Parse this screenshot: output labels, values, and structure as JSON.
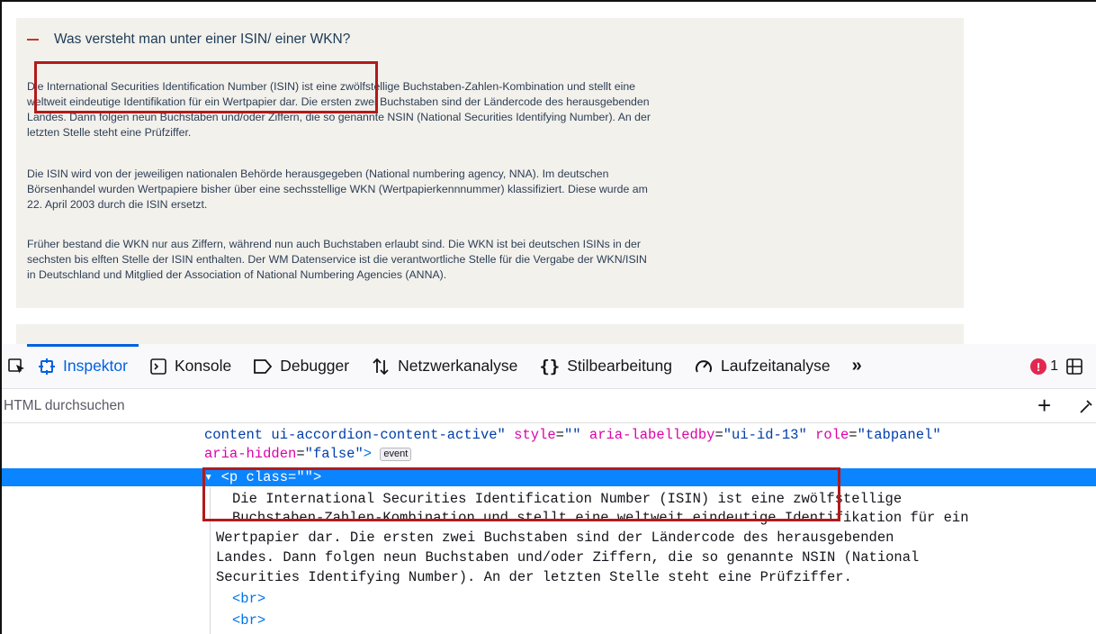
{
  "accordion": {
    "title": "Was versteht man unter einer ISIN/ einer WKN?",
    "paragraphs": [
      [
        "Die International Securities Identification Number (ISIN) ist eine zwölfstellige Buchstaben-Zahlen-Kombination und stellt eine",
        "weltweit eindeutige Identifikation für ein Wertpapier dar. Die ersten zwei Buchstaben sind der Ländercode des herausgebenden",
        "Landes. Dann folgen neun Buchstaben und/oder Ziffern, die so genannte NSIN (National Securities Identifying Number). An der",
        "letzten Stelle steht eine Prüfziffer."
      ],
      [
        "Die ISIN wird von der jeweiligen nationalen Behörde herausgegeben (National numbering agency, NNA). Im deutschen",
        "Börsenhandel wurden Wertpapiere bisher über eine sechsstellige WKN (Wertpapierkennnummer) klassifiziert. Diese wurde am",
        "22. April 2003 durch die ISIN ersetzt."
      ],
      [
        "Früher bestand die WKN nur aus Ziffern, während nun auch Buchstaben erlaubt sind. Die WKN ist bei deutschen ISINs in der",
        "sechsten bis elften Stelle der ISIN enthalten. Der WM Datenservice ist die verantwortliche Stelle für die Vergabe der WKN/ISIN",
        "in Deutschland und Mitglied der Association of National Numbering Agencies (ANNA)."
      ]
    ]
  },
  "devtools": {
    "tabs": [
      {
        "label": "Inspektor",
        "icon": "inspector-icon",
        "active": true
      },
      {
        "label": "Konsole",
        "icon": "console-icon",
        "active": false
      },
      {
        "label": "Debugger",
        "icon": "debugger-icon",
        "active": false
      },
      {
        "label": "Netzwerkanalyse",
        "icon": "network-icon",
        "active": false
      },
      {
        "label": "Stilbearbeitung",
        "icon": "style-editor-icon",
        "active": false
      },
      {
        "label": "Laufzeitanalyse",
        "icon": "performance-icon",
        "active": false
      }
    ],
    "more_tabs": "»",
    "error_count": "1",
    "search_placeholder": "HTML durchsuchen",
    "add_node": "+",
    "markup": {
      "l1_text": "content ui-accordion-content-active\" ",
      "l1_attr1": "style",
      "l1_val1": "\"\"",
      "l1_attr2": "aria-labelledby",
      "l1_val2": "\"ui-id-13\"",
      "l1_attr3": "role",
      "l1_val3": "\"tabpanel\"",
      "l2_attr": "aria-hidden",
      "l2_val": "\"false\"",
      "event_badge": "event",
      "selected_tag": "▾ <p class=\"\">",
      "text_lines": [
        "Die International Securities Identification Number (ISIN) ist eine zwölfstellige",
        "Buchstaben-Zahlen-Kombination und stellt eine weltweit eindeutige Identifikation für ein",
        "Wertpapier dar. Die ersten zwei Buchstaben sind der Ländercode des herausgebenden",
        "Landes. Dann folgen neun Buchstaben und/oder Ziffern, die so genannte NSIN (National",
        "Securities Identifying Number). An der letzten Stelle steht eine Prüfziffer."
      ],
      "br1": "<br>",
      "br2": "<br>"
    }
  },
  "colors": {
    "highlight_box": "#b21a1a",
    "active_tab": "#0061e0",
    "selection_row": "#0a84ff",
    "accordion_bg": "#f3f1ec"
  }
}
